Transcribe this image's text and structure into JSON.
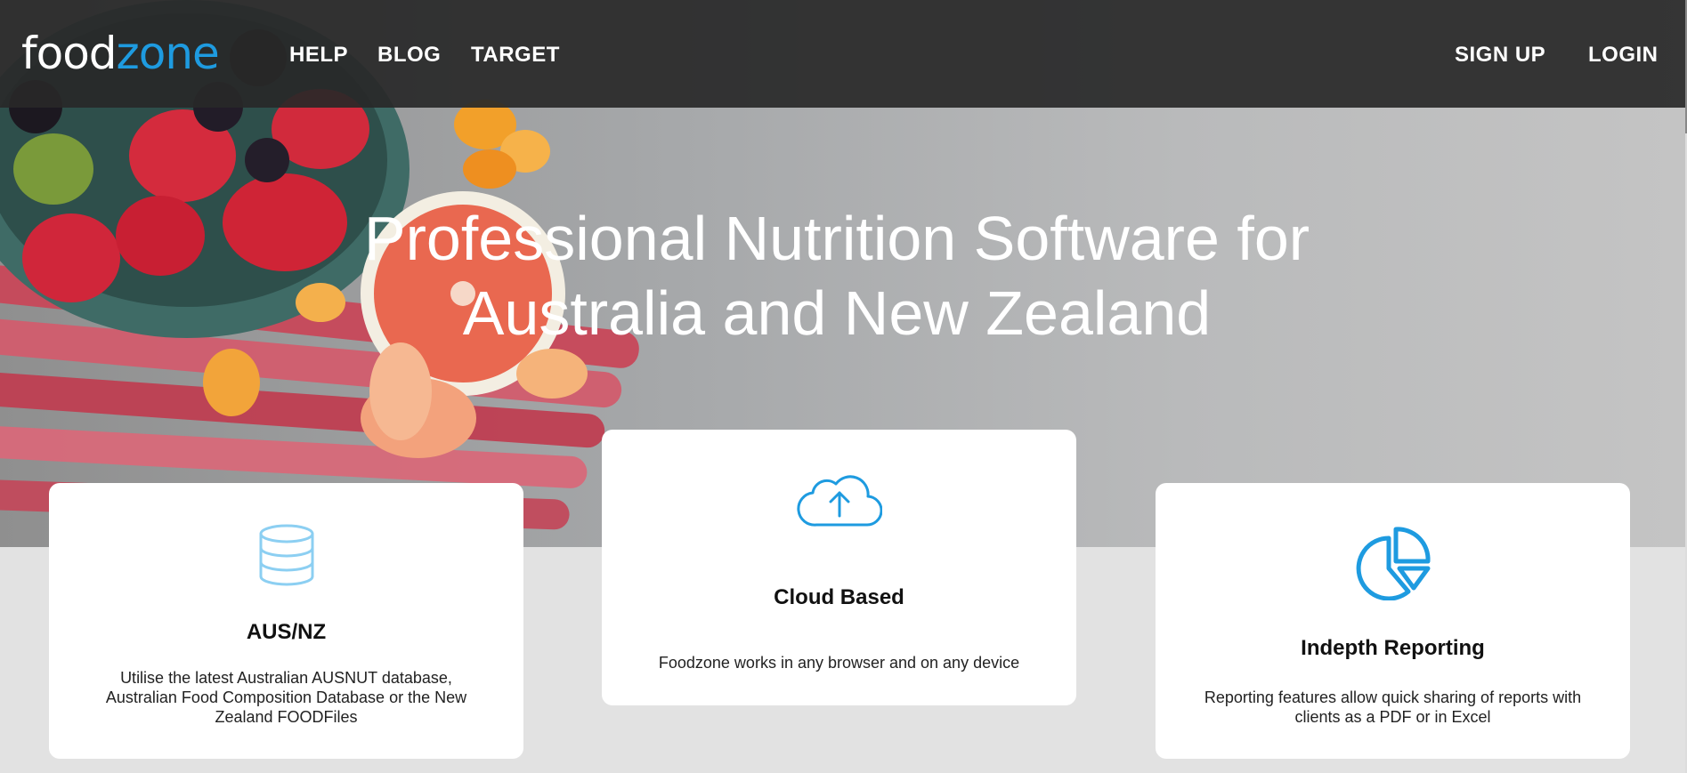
{
  "brand": {
    "logo_part1": "food",
    "logo_part2": "zone",
    "accent": "#1e9be0"
  },
  "nav": {
    "left": [
      {
        "label": "HELP"
      },
      {
        "label": "BLOG"
      },
      {
        "label": "TARGET"
      }
    ],
    "right": [
      {
        "label": "SIGN UP"
      },
      {
        "label": "LOGIN"
      }
    ]
  },
  "hero": {
    "title_line1": "Professional Nutrition Software for",
    "title_line2": "Australia and New Zealand"
  },
  "features": [
    {
      "icon": "database-icon",
      "title": "AUS/NZ",
      "desc": "Utilise the latest Australian AUSNUT database, Australian Food Composition Database or the New Zealand FOODFiles"
    },
    {
      "icon": "cloud-upload-icon",
      "title": "Cloud Based",
      "desc": "Foodzone works in any browser and on any device"
    },
    {
      "icon": "pie-chart-icon",
      "title": "Indepth Reporting",
      "desc": "Reporting features allow quick sharing of reports with clients as a PDF or in Excel"
    }
  ]
}
